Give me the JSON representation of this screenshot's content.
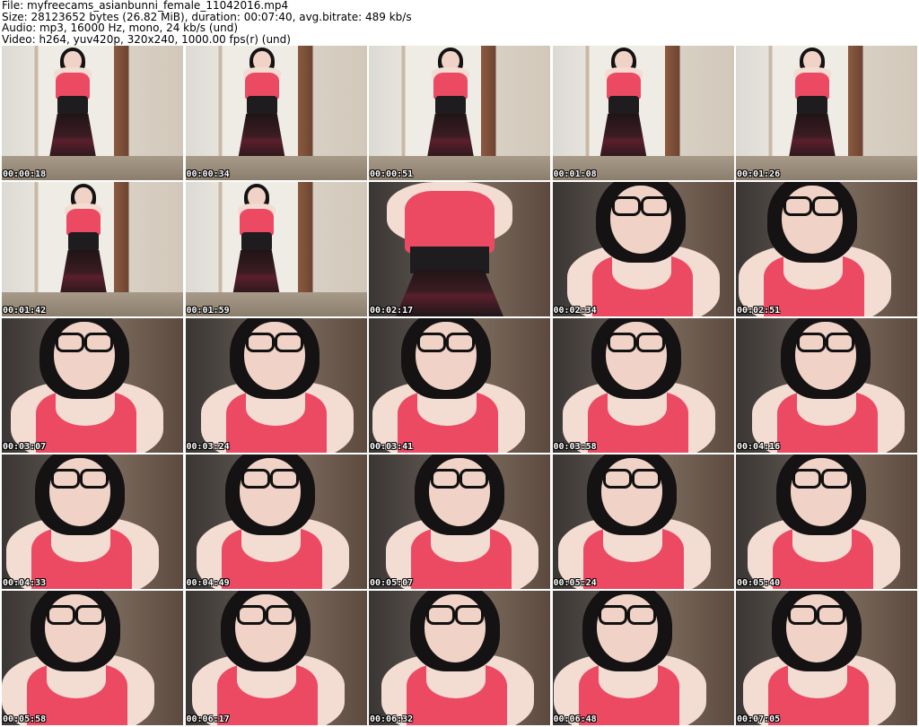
{
  "header": {
    "line1": "File: myfreecams_asianbunni_female_11042016.mp4",
    "line2": "Size: 28123652 bytes (26.82 MiB), duration: 00:07:40, avg.bitrate: 489 kb/s",
    "line3": "Audio: mp3, 16000 Hz, mono, 24 kb/s (und)",
    "line4": "Video: h264, yuv420p, 320x240, 1000.00 fps(r) (und)"
  },
  "thumbnails": [
    {
      "time": "00:00:18",
      "shot": "wide"
    },
    {
      "time": "00:00:34",
      "shot": "wide"
    },
    {
      "time": "00:00:51",
      "shot": "wide"
    },
    {
      "time": "00:01:08",
      "shot": "wide"
    },
    {
      "time": "00:01:26",
      "shot": "wide"
    },
    {
      "time": "00:01:42",
      "shot": "wide"
    },
    {
      "time": "00:01:59",
      "shot": "wide"
    },
    {
      "time": "00:02:17",
      "shot": "medium"
    },
    {
      "time": "00:02:34",
      "shot": "close"
    },
    {
      "time": "00:02:51",
      "shot": "close"
    },
    {
      "time": "00:03:07",
      "shot": "close"
    },
    {
      "time": "00:03:24",
      "shot": "close"
    },
    {
      "time": "00:03:41",
      "shot": "close"
    },
    {
      "time": "00:03:58",
      "shot": "close"
    },
    {
      "time": "00:04:16",
      "shot": "close"
    },
    {
      "time": "00:04:33",
      "shot": "close"
    },
    {
      "time": "00:04:49",
      "shot": "close"
    },
    {
      "time": "00:05:07",
      "shot": "close"
    },
    {
      "time": "00:05:24",
      "shot": "close"
    },
    {
      "time": "00:05:40",
      "shot": "close"
    },
    {
      "time": "00:05:58",
      "shot": "close"
    },
    {
      "time": "00:06:17",
      "shot": "close"
    },
    {
      "time": "00:06:32",
      "shot": "close"
    },
    {
      "time": "00:06:48",
      "shot": "close"
    },
    {
      "time": "00:07:05",
      "shot": "close"
    }
  ]
}
